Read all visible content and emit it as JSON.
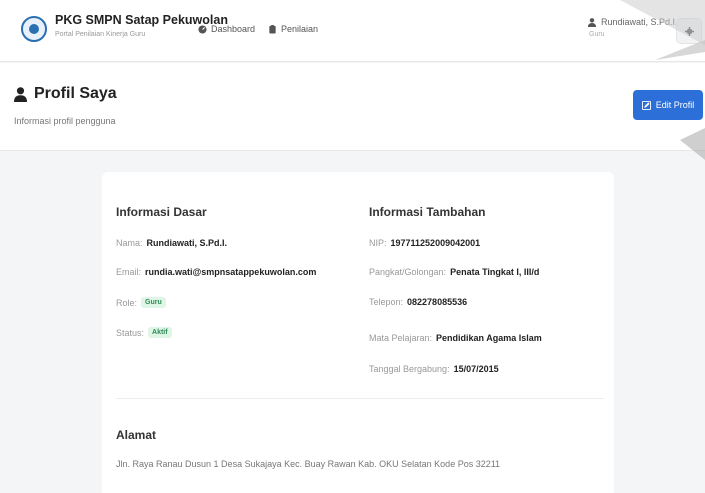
{
  "app": {
    "name": "PKG SMPN Satap Pekuwolan",
    "subtitle": "Portal Penilaian Kinerja Guru"
  },
  "nav": [
    {
      "label": "Dashboard",
      "icon": "dashboard-icon"
    },
    {
      "label": "Penilaian",
      "icon": "clipboard-icon"
    }
  ],
  "user": {
    "name": "Rundiawati, S.Pd.I.",
    "role": "Guru"
  },
  "page": {
    "title": "Profil Saya",
    "subtitle": "Informasi profil pengguna",
    "edit_label": "Edit Profil"
  },
  "basic": {
    "title": "Informasi Dasar",
    "name_label": "Nama:",
    "name": "Rundiawati, S.Pd.I.",
    "email_label": "Email:",
    "email": "rundia.wati@smpnsatappekuwolan.com",
    "role_label": "Role:",
    "role": "Guru",
    "status_label": "Status:",
    "status": "Aktif"
  },
  "extra": {
    "title": "Informasi Tambahan",
    "nip_label": "NIP:",
    "nip": "197711252009042001",
    "rank_label": "Pangkat/Golongan:",
    "rank": "Penata Tingkat I, III/d",
    "phone_label": "Telepon:",
    "phone": "082278085536",
    "subject_label": "Mata Pelajaran:",
    "subject": "Pendidikan Agama Islam",
    "join_label": "Tanggal Bergabung:",
    "join": "15/07/2015"
  },
  "address": {
    "title": "Alamat",
    "text": "Jln. Raya Ranau Dusun 1 Desa Sukajaya Kec. Buay Rawan Kab. OKU Selatan Kode Pos 32211"
  },
  "colors": {
    "primary": "#2d6fd8",
    "badge_bg": "#dff5e6",
    "badge_fg": "#2e8b57"
  }
}
